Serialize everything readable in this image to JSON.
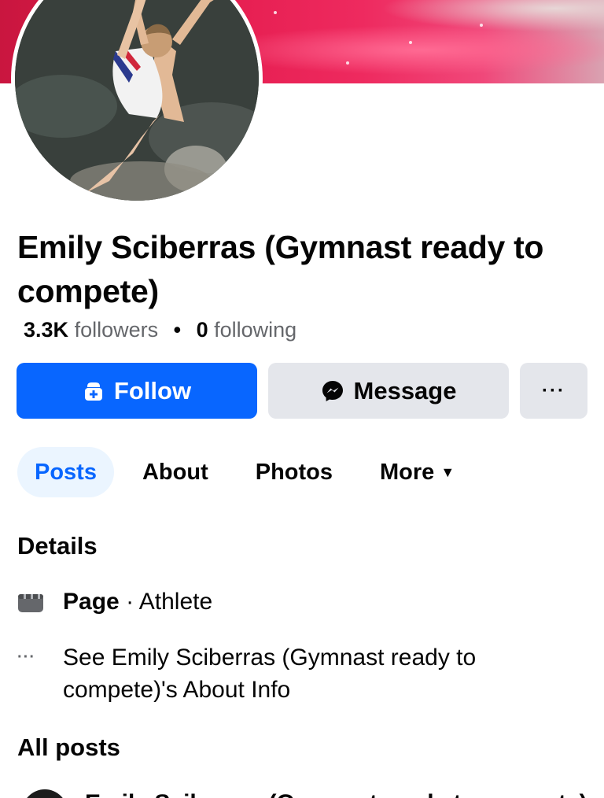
{
  "profile": {
    "name": "Emily Sciberras (Gymnast ready to compete)",
    "followers_count": "3.3K",
    "followers_label": "followers",
    "separator": "•",
    "following_count": "0",
    "following_label": "following"
  },
  "actions": {
    "follow_label": "Follow",
    "message_label": "Message",
    "more_label": "···"
  },
  "tabs": [
    {
      "label": "Posts",
      "active": true
    },
    {
      "label": "About",
      "active": false
    },
    {
      "label": "Photos",
      "active": false
    },
    {
      "label": "More",
      "active": false
    }
  ],
  "details": {
    "title": "Details",
    "page_label": "Page",
    "page_separator": "·",
    "category": "Athlete",
    "about_link": "See Emily Sciberras (Gymnast ready to compete)'s About Info",
    "more_icon": "···"
  },
  "all_posts": {
    "title": "All posts",
    "peek_text": "Emily Sciberras (Gymnast ready to compete)"
  },
  "colors": {
    "primary": "#0866ff",
    "secondary_button": "#e4e6eb",
    "active_tab_bg": "#ebf5ff",
    "muted_text": "#65676b"
  }
}
